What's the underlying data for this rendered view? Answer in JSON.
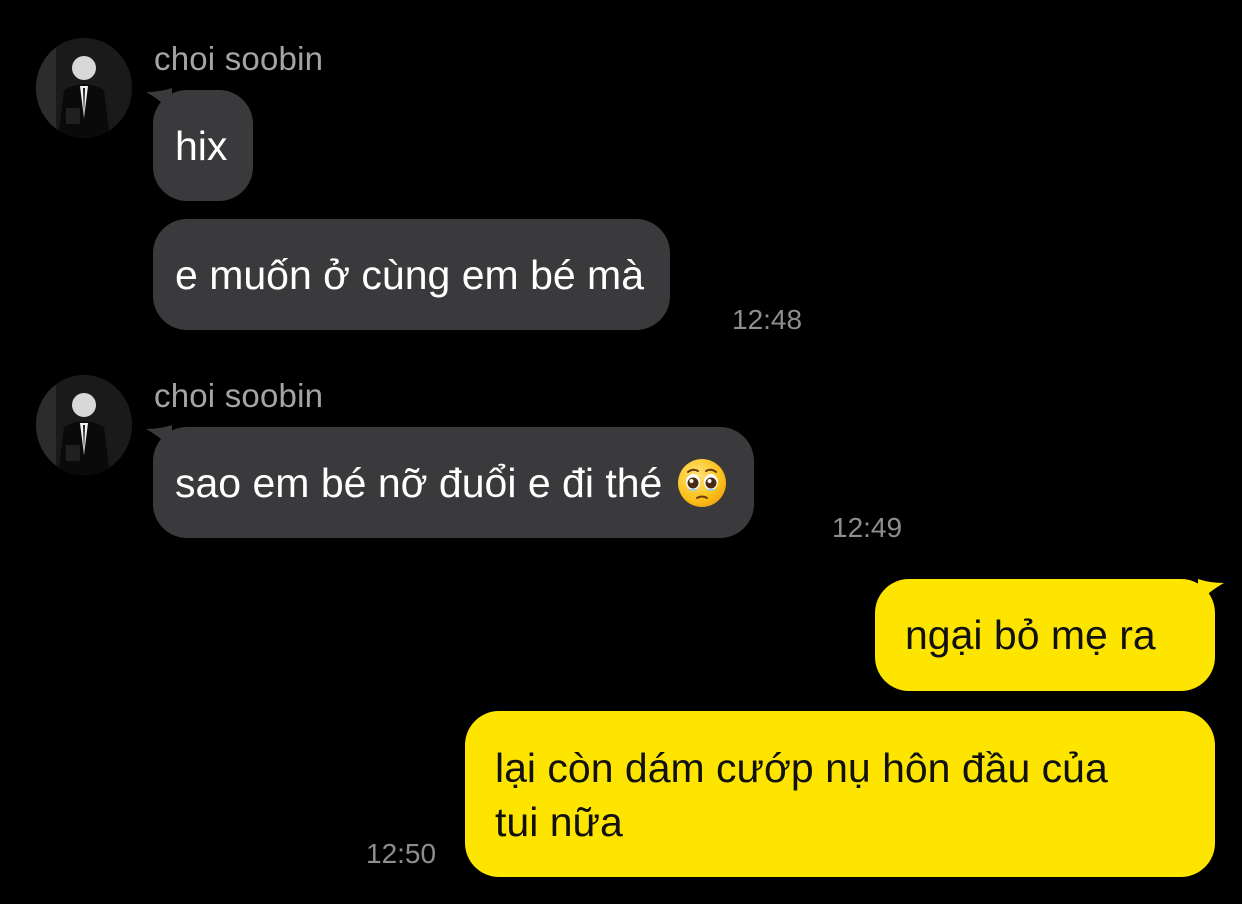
{
  "conversation": {
    "incoming_group_1": {
      "sender_name": "choi soobin",
      "avatar_icon": "profile-photo-icon",
      "messages": [
        {
          "text": "hix"
        },
        {
          "text": "e muốn ở cùng em bé mà"
        }
      ],
      "timestamp": "12:48"
    },
    "incoming_group_2": {
      "sender_name": "choi soobin",
      "avatar_icon": "profile-photo-icon",
      "messages": [
        {
          "text": "sao em bé nỡ đuổi e đi thé",
          "emoji": "pleading-face-emoji"
        }
      ],
      "timestamp": "12:49"
    },
    "outgoing_group": {
      "messages": [
        {
          "text": "ngại bỏ mẹ ra"
        },
        {
          "line1": "lại còn dám cướp nụ hôn đầu của",
          "line2": "tui nữa"
        }
      ],
      "timestamp": "12:50"
    }
  },
  "colors": {
    "background": "#000000",
    "incoming_bubble": "#3a3a3c",
    "outgoing_bubble": "#fee500",
    "sender_name": "#a4a4a4",
    "timestamp": "#8e8e8e"
  }
}
